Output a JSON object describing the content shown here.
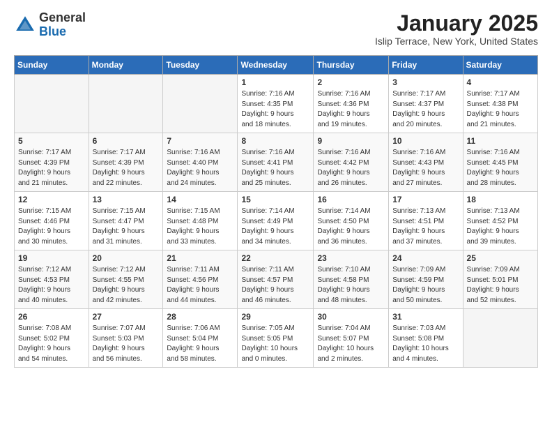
{
  "header": {
    "logo_line1": "General",
    "logo_line2": "Blue",
    "month_title": "January 2025",
    "location": "Islip Terrace, New York, United States"
  },
  "days_of_week": [
    "Sunday",
    "Monday",
    "Tuesday",
    "Wednesday",
    "Thursday",
    "Friday",
    "Saturday"
  ],
  "weeks": [
    [
      {
        "day": "",
        "info": ""
      },
      {
        "day": "",
        "info": ""
      },
      {
        "day": "",
        "info": ""
      },
      {
        "day": "1",
        "info": "Sunrise: 7:16 AM\nSunset: 4:35 PM\nDaylight: 9 hours\nand 18 minutes."
      },
      {
        "day": "2",
        "info": "Sunrise: 7:16 AM\nSunset: 4:36 PM\nDaylight: 9 hours\nand 19 minutes."
      },
      {
        "day": "3",
        "info": "Sunrise: 7:17 AM\nSunset: 4:37 PM\nDaylight: 9 hours\nand 20 minutes."
      },
      {
        "day": "4",
        "info": "Sunrise: 7:17 AM\nSunset: 4:38 PM\nDaylight: 9 hours\nand 21 minutes."
      }
    ],
    [
      {
        "day": "5",
        "info": "Sunrise: 7:17 AM\nSunset: 4:39 PM\nDaylight: 9 hours\nand 21 minutes."
      },
      {
        "day": "6",
        "info": "Sunrise: 7:17 AM\nSunset: 4:39 PM\nDaylight: 9 hours\nand 22 minutes."
      },
      {
        "day": "7",
        "info": "Sunrise: 7:16 AM\nSunset: 4:40 PM\nDaylight: 9 hours\nand 24 minutes."
      },
      {
        "day": "8",
        "info": "Sunrise: 7:16 AM\nSunset: 4:41 PM\nDaylight: 9 hours\nand 25 minutes."
      },
      {
        "day": "9",
        "info": "Sunrise: 7:16 AM\nSunset: 4:42 PM\nDaylight: 9 hours\nand 26 minutes."
      },
      {
        "day": "10",
        "info": "Sunrise: 7:16 AM\nSunset: 4:43 PM\nDaylight: 9 hours\nand 27 minutes."
      },
      {
        "day": "11",
        "info": "Sunrise: 7:16 AM\nSunset: 4:45 PM\nDaylight: 9 hours\nand 28 minutes."
      }
    ],
    [
      {
        "day": "12",
        "info": "Sunrise: 7:15 AM\nSunset: 4:46 PM\nDaylight: 9 hours\nand 30 minutes."
      },
      {
        "day": "13",
        "info": "Sunrise: 7:15 AM\nSunset: 4:47 PM\nDaylight: 9 hours\nand 31 minutes."
      },
      {
        "day": "14",
        "info": "Sunrise: 7:15 AM\nSunset: 4:48 PM\nDaylight: 9 hours\nand 33 minutes."
      },
      {
        "day": "15",
        "info": "Sunrise: 7:14 AM\nSunset: 4:49 PM\nDaylight: 9 hours\nand 34 minutes."
      },
      {
        "day": "16",
        "info": "Sunrise: 7:14 AM\nSunset: 4:50 PM\nDaylight: 9 hours\nand 36 minutes."
      },
      {
        "day": "17",
        "info": "Sunrise: 7:13 AM\nSunset: 4:51 PM\nDaylight: 9 hours\nand 37 minutes."
      },
      {
        "day": "18",
        "info": "Sunrise: 7:13 AM\nSunset: 4:52 PM\nDaylight: 9 hours\nand 39 minutes."
      }
    ],
    [
      {
        "day": "19",
        "info": "Sunrise: 7:12 AM\nSunset: 4:53 PM\nDaylight: 9 hours\nand 40 minutes."
      },
      {
        "day": "20",
        "info": "Sunrise: 7:12 AM\nSunset: 4:55 PM\nDaylight: 9 hours\nand 42 minutes."
      },
      {
        "day": "21",
        "info": "Sunrise: 7:11 AM\nSunset: 4:56 PM\nDaylight: 9 hours\nand 44 minutes."
      },
      {
        "day": "22",
        "info": "Sunrise: 7:11 AM\nSunset: 4:57 PM\nDaylight: 9 hours\nand 46 minutes."
      },
      {
        "day": "23",
        "info": "Sunrise: 7:10 AM\nSunset: 4:58 PM\nDaylight: 9 hours\nand 48 minutes."
      },
      {
        "day": "24",
        "info": "Sunrise: 7:09 AM\nSunset: 4:59 PM\nDaylight: 9 hours\nand 50 minutes."
      },
      {
        "day": "25",
        "info": "Sunrise: 7:09 AM\nSunset: 5:01 PM\nDaylight: 9 hours\nand 52 minutes."
      }
    ],
    [
      {
        "day": "26",
        "info": "Sunrise: 7:08 AM\nSunset: 5:02 PM\nDaylight: 9 hours\nand 54 minutes."
      },
      {
        "day": "27",
        "info": "Sunrise: 7:07 AM\nSunset: 5:03 PM\nDaylight: 9 hours\nand 56 minutes."
      },
      {
        "day": "28",
        "info": "Sunrise: 7:06 AM\nSunset: 5:04 PM\nDaylight: 9 hours\nand 58 minutes."
      },
      {
        "day": "29",
        "info": "Sunrise: 7:05 AM\nSunset: 5:05 PM\nDaylight: 10 hours\nand 0 minutes."
      },
      {
        "day": "30",
        "info": "Sunrise: 7:04 AM\nSunset: 5:07 PM\nDaylight: 10 hours\nand 2 minutes."
      },
      {
        "day": "31",
        "info": "Sunrise: 7:03 AM\nSunset: 5:08 PM\nDaylight: 10 hours\nand 4 minutes."
      },
      {
        "day": "",
        "info": ""
      }
    ]
  ]
}
